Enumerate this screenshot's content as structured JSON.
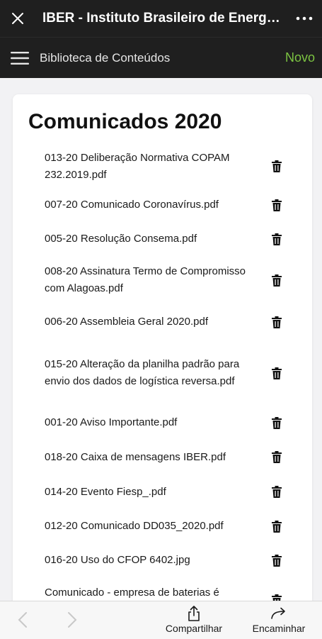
{
  "header": {
    "title": "IBER - Instituto Brasileiro de Energia Reciclável"
  },
  "nav": {
    "title": "Biblioteca de Conteúdos",
    "new_label": "Novo"
  },
  "section": {
    "title": "Comunicados 2020"
  },
  "files": [
    {
      "name": "013-20 Deliberação Normativa COPAM 232.2019.pdf"
    },
    {
      "name": "007-20 Comunicado Coronavírus.pdf"
    },
    {
      "name": "005-20 Resolução Consema.pdf"
    },
    {
      "name": "008-20 Assinatura Termo de Compromisso com Alagoas.pdf"
    },
    {
      "name": "006-20 Assembleia Geral 2020.pdf"
    },
    {
      "name": "015-20 Alteração da planilha padrão para envio dos dados de logística reversa.pdf"
    },
    {
      "name": "001-20 Aviso Importante.pdf"
    },
    {
      "name": "018-20 Caixa de mensagens IBER.pdf"
    },
    {
      "name": "014-20 Evento Fiesp_.pdf"
    },
    {
      "name": "012-20 Comunicado DD035_2020.pdf"
    },
    {
      "name": "016-20 Uso do CFOP 6402.jpg"
    },
    {
      "name": "Comunicado - empresa de baterias é"
    }
  ],
  "toolbar": {
    "share_label": "Compartilhar",
    "forward_label": "Encaminhar"
  },
  "colors": {
    "header_bg": "#1f1f1f",
    "accent_green": "#7cc442",
    "page_bg": "#f2f2f4"
  }
}
